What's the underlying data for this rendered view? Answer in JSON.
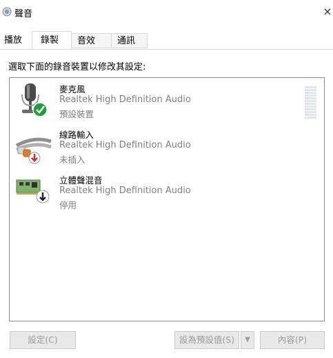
{
  "window": {
    "title": "聲音",
    "close_glyph": "×"
  },
  "tabs": [
    {
      "label": "播放"
    },
    {
      "label": "錄製",
      "active": true
    },
    {
      "label": "音效"
    },
    {
      "label": "通訊"
    }
  ],
  "instruction": "選取下面的錄音裝置以修改其設定:",
  "devices": [
    {
      "name": "麥克風",
      "driver": "Realtek High Definition Audio",
      "status": "預設裝置",
      "icon": "microphone-icon",
      "badge": "green-check-icon"
    },
    {
      "name": "線路輸入",
      "driver": "Realtek High Definition Audio",
      "status": "未插入",
      "icon": "rca-cable-icon",
      "badge": "red-down-arrow-icon"
    },
    {
      "name": "立體聲混音",
      "driver": "Realtek High Definition Audio",
      "status": "停用",
      "icon": "sound-card-icon",
      "badge": "black-down-arrow-icon"
    }
  ],
  "buttons": {
    "configure": "設定(C)",
    "set_default": "設為預設值(S)",
    "set_default_arrow": "▼",
    "properties": "內容(P)"
  },
  "level_meter": {
    "level": 0
  },
  "colors": {
    "accent_check": "#1f9e3b",
    "badge_red": "#d22a2a",
    "muted_text": "#808080"
  }
}
